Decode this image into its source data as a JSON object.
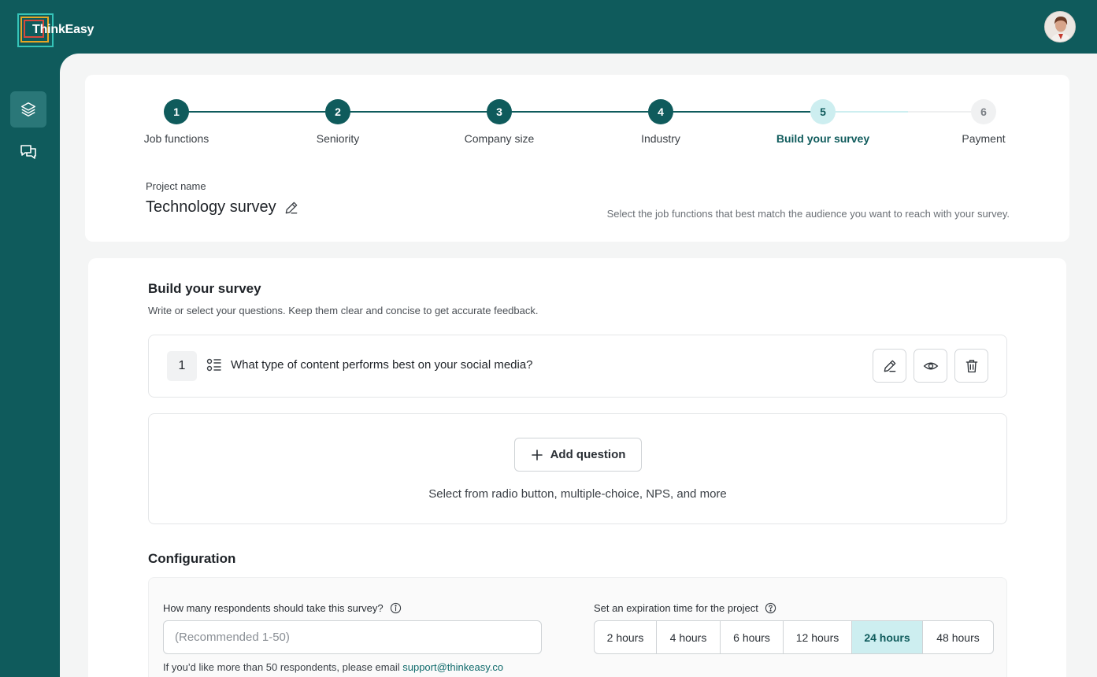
{
  "brand": {
    "name": "ThinkEasy"
  },
  "user": {
    "avatar_icon": "user-avatar"
  },
  "sidebar": {
    "items": [
      {
        "icon": "layers-icon",
        "active": true
      },
      {
        "icon": "chat-icon",
        "active": false
      }
    ]
  },
  "stepper": {
    "steps": [
      {
        "number": "1",
        "label": "Job functions",
        "state": "done"
      },
      {
        "number": "2",
        "label": "Seniority",
        "state": "done"
      },
      {
        "number": "3",
        "label": "Company size",
        "state": "done"
      },
      {
        "number": "4",
        "label": "Industry",
        "state": "done"
      },
      {
        "number": "5",
        "label": "Build your survey",
        "state": "current"
      },
      {
        "number": "6",
        "label": "Payment",
        "state": "todo"
      }
    ]
  },
  "project": {
    "label": "Project name",
    "name": "Technology survey",
    "hint": "Select the job functions that best match the audience you want to reach with your survey."
  },
  "builder": {
    "title": "Build your survey",
    "subtitle": "Write or select your questions. Keep them clear and concise to get accurate feedback.",
    "questions": [
      {
        "number": "1",
        "text": "What type of content performs best on your social media?"
      }
    ],
    "add_button": "Add question",
    "add_hint": "Select from radio button, multiple-choice, NPS, and more"
  },
  "config": {
    "title": "Configuration",
    "respondents_label": "How many respondents should take this survey?",
    "respondents_placeholder": "(Recommended 1-50)",
    "respondents_help": "If you’d like more than 50 respondents, please email ",
    "support_email": "support@thinkeasy.co",
    "expiration_label": "Set an expiration time for the project",
    "expiration_options": [
      "2 hours",
      "4 hours",
      "6 hours",
      "12 hours",
      "24 hours",
      "48 hours"
    ],
    "expiration_selected": "24 hours"
  },
  "colors": {
    "brand": "#0f5b5c",
    "accent_light": "#cdeef0"
  }
}
